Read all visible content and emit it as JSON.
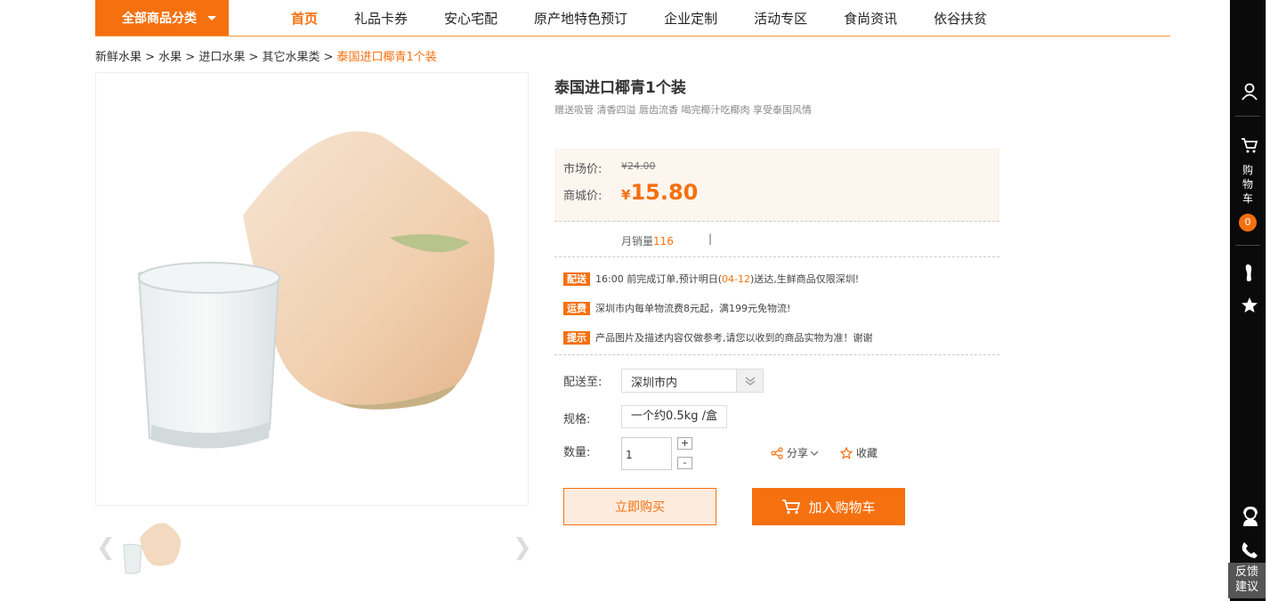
{
  "nav": {
    "category_label": "全部商品分类",
    "items": [
      "首页",
      "礼品卡券",
      "安心宅配",
      "原产地特色预订",
      "企业定制",
      "活动专区",
      "食尚资讯",
      "依谷扶贫"
    ],
    "active_index": 0
  },
  "breadcrumb": {
    "path": "新鲜水果 > 水果 > 进口水果 > 其它水果类 >",
    "current": "泰国进口椰青1个装"
  },
  "product": {
    "title": "泰国进口椰青1个装",
    "subtitle": "赠送吸管 清香四溢 唇齿流香 喝完椰汁吃椰肉 享受泰国风情",
    "market_price_label": "市场价:",
    "market_price": "¥24.00",
    "shop_price_label": "商城价:",
    "shop_price_currency": "¥",
    "shop_price": "15.80",
    "monthly_sales_label": "月销量",
    "monthly_sales": "116",
    "sales_divider": "|"
  },
  "notes": [
    {
      "tag": "配送",
      "text_before": "16:00 前完成订单,预计明日(",
      "highlight": "04-12",
      "text_after": ")送达,生鲜商品仅限深圳!"
    },
    {
      "tag": "运费",
      "text": "深圳市内每单物流费8元起，满199元免物流!"
    },
    {
      "tag": "提示",
      "text": "产品图片及描述内容仅做参考,请您以收到的商品实物为准！谢谢"
    }
  ],
  "options": {
    "ship_label": "配送至:",
    "ship_value": "深圳市内",
    "spec_label": "规格:",
    "spec_value": "一个约0.5kg /盒",
    "qty_label": "数量:",
    "qty_value": "1",
    "plus": "+",
    "minus": "-",
    "share_label": "分享",
    "fav_label": "收藏"
  },
  "buttons": {
    "buy_now": "立即购买",
    "add_cart": "加入购物车"
  },
  "sidebar": {
    "cart_label_1": "购",
    "cart_label_2": "物",
    "cart_label_3": "车",
    "cart_count": "0",
    "feedback_1": "反馈",
    "feedback_2": "建议"
  },
  "colors": {
    "accent": "#f5700f",
    "price_bg": "#fdf6ef",
    "sidebar_bg": "#0a0a0a"
  },
  "icons": [
    "chevron-left-icon",
    "chevron-right-icon",
    "share-icon",
    "star-icon",
    "cart-icon",
    "user-icon",
    "footprint-icon",
    "service-icon",
    "phone-icon"
  ]
}
